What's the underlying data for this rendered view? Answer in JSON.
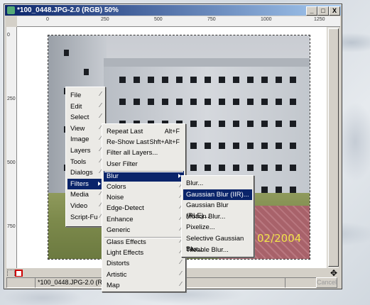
{
  "window": {
    "title": "*100_0448.JPG-2.0 (RGB) 50%",
    "buttons": {
      "minimize": "_",
      "maximize": "□",
      "close": "X"
    }
  },
  "ruler": {
    "top_labels": [
      "0",
      "250",
      "500",
      "750",
      "1000",
      "1250"
    ],
    "left_labels": [
      "0",
      "250",
      "500",
      "750"
    ]
  },
  "photo": {
    "date_stamp": "02/2004"
  },
  "statusbar": {
    "image_name": "*100_0448.JPG-2.0 (RGB)",
    "cancel_label": "Cancel"
  },
  "menu_main": {
    "items": [
      {
        "label": "File"
      },
      {
        "label": "Edit"
      },
      {
        "label": "Select"
      },
      {
        "label": "View"
      },
      {
        "label": "Image"
      },
      {
        "label": "Layers"
      },
      {
        "label": "Tools"
      },
      {
        "label": "Dialogs"
      },
      {
        "label": "Filters",
        "selected": true
      },
      {
        "label": "Media"
      },
      {
        "label": "Video"
      },
      {
        "label": "Script-Fu"
      }
    ]
  },
  "menu_filters": {
    "items": [
      {
        "label": "Repeat Last",
        "accel": "Alt+F"
      },
      {
        "label": "Re-Show Last",
        "accel": "Shft+Alt+F"
      },
      {
        "label": "Filter all Layers..."
      },
      {
        "label": "User Filter"
      },
      {
        "label": "Blur",
        "selected": true
      },
      {
        "label": "Colors"
      },
      {
        "label": "Noise"
      },
      {
        "label": "Edge-Detect"
      },
      {
        "label": "Enhance"
      },
      {
        "label": "Generic"
      },
      {
        "label": "Glass Effects"
      },
      {
        "label": "Light Effects"
      },
      {
        "label": "Distorts"
      },
      {
        "label": "Artistic"
      },
      {
        "label": "Map"
      }
    ]
  },
  "menu_blur": {
    "items": [
      {
        "label": "Blur..."
      },
      {
        "label": "Gaussian Blur (IIR)...",
        "selected": true
      },
      {
        "label": "Gaussian Blur (RLE)..."
      },
      {
        "label": "Motion Blur..."
      },
      {
        "label": "Pixelize..."
      },
      {
        "label": "Selective Gaussian Blur..."
      },
      {
        "label": "Tileable Blur..."
      }
    ]
  },
  "colors": {
    "selection": "#0a246a",
    "menu_bg": "#ebeae6",
    "window_bg": "#d4d0c8"
  }
}
